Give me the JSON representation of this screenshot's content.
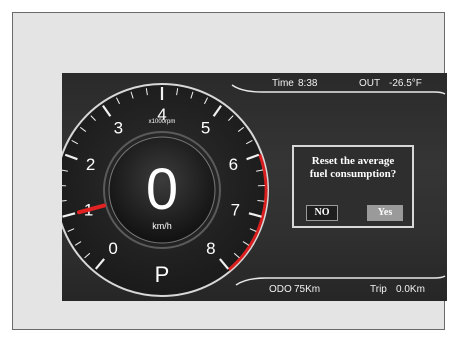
{
  "header": {
    "time_label": "Time",
    "time_value": "8:38",
    "out_label": "OUT",
    "out_value": "-26.5°F"
  },
  "footer": {
    "odo_label": "ODO",
    "odo_value": "75Km",
    "trip_label": "Trip",
    "trip_value": "0.0Km"
  },
  "gauge": {
    "tick_labels": [
      "0",
      "1",
      "2",
      "3",
      "4",
      "5",
      "6",
      "7",
      "8"
    ],
    "unit_rpm": "x1000rpm",
    "speed_value": "0",
    "speed_unit": "km/h",
    "gear": "P",
    "redline_start": 6,
    "rpm_needle": 1,
    "colors": {
      "redline": "#d81e1e",
      "needle": "#e02222"
    }
  },
  "dialog": {
    "message_line1": "Reset the average",
    "message_line2": "fuel consumption?",
    "no_label": "NO",
    "yes_label": "Yes"
  }
}
